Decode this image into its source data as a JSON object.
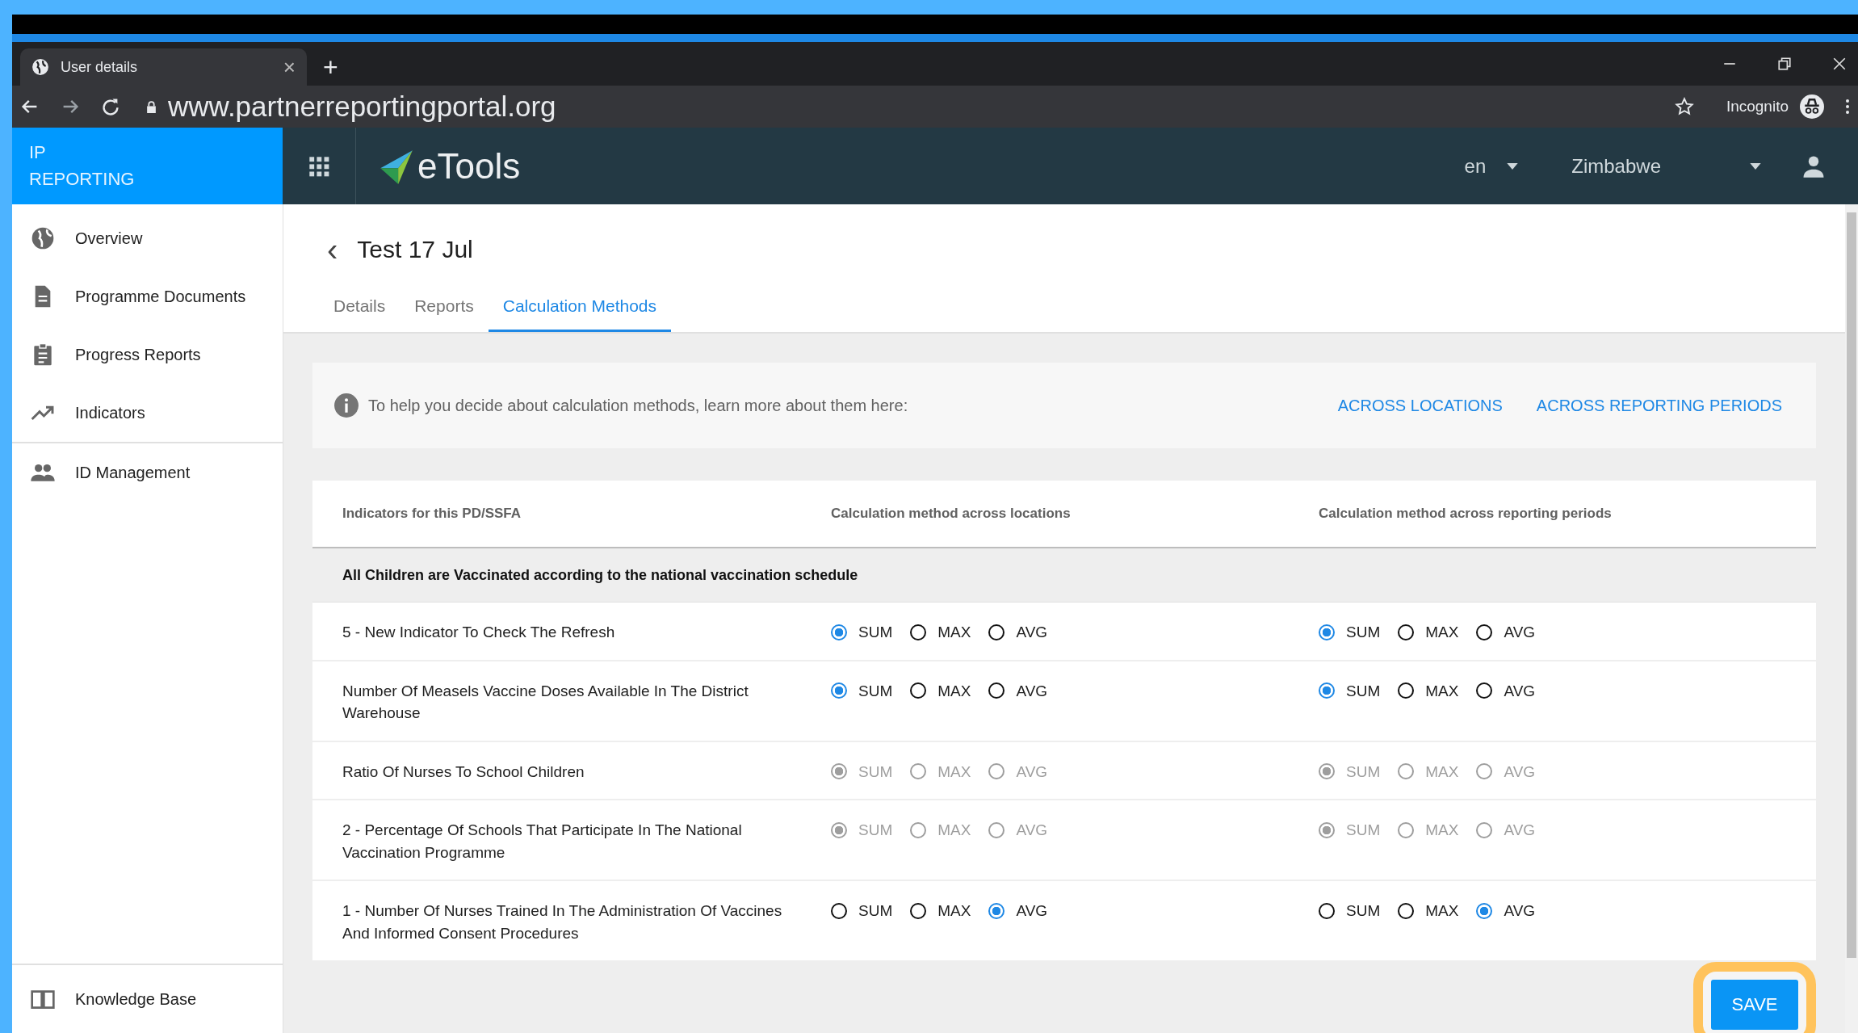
{
  "browser": {
    "tab": {
      "title": "User details",
      "close": "×"
    },
    "new_tab": "+",
    "url": "www.partnerreportingportal.org",
    "profile": "Incognito"
  },
  "app_header": {
    "brand": [
      "IP",
      "REPORTING"
    ],
    "logo_text": "eTools",
    "language": "en",
    "country": "Zimbabwe"
  },
  "sidebar": {
    "items": [
      {
        "label": "Overview",
        "kind": "globe",
        "selected": false
      },
      {
        "label": "Programme Documents",
        "kind": "document",
        "selected": false
      },
      {
        "label": "Progress Reports",
        "kind": "clipboard",
        "selected": false
      },
      {
        "label": "Indicators",
        "kind": "trend",
        "selected": false
      },
      {
        "label": "ID Management",
        "kind": "people",
        "selected": false
      }
    ],
    "footer_item": {
      "label": "Knowledge Base",
      "kind": "book"
    }
  },
  "page": {
    "back": "‹",
    "title": "Test 17 Jul",
    "tabs": [
      {
        "label": "Details",
        "selected": false
      },
      {
        "label": "Reports",
        "selected": false
      },
      {
        "label": "Calculation Methods",
        "selected": true
      }
    ]
  },
  "info": {
    "text": "To help you decide about calculation methods, learn more about them here:",
    "links": [
      "ACROSS LOCATIONS",
      "ACROSS REPORTING PERIODS"
    ]
  },
  "table": {
    "columns": [
      "Indicators for this PD/SSFA",
      "Calculation method across locations",
      "Calculation method across reporting periods"
    ],
    "group": "All Children are Vaccinated according to the national vaccination schedule",
    "rows": [
      {
        "indicator": "5 - New Indicator To Check The Refresh",
        "disabled": false,
        "locations": [
          {
            "label": "SUM",
            "selected": true
          },
          {
            "label": "MAX",
            "selected": false
          },
          {
            "label": "AVG",
            "selected": false
          }
        ],
        "periods": [
          {
            "label": "SUM",
            "selected": true
          },
          {
            "label": "MAX",
            "selected": false
          },
          {
            "label": "AVG",
            "selected": false
          }
        ]
      },
      {
        "indicator": "Number Of Measels Vaccine Doses Available In The District Warehouse",
        "disabled": false,
        "locations": [
          {
            "label": "SUM",
            "selected": true
          },
          {
            "label": "MAX",
            "selected": false
          },
          {
            "label": "AVG",
            "selected": false
          }
        ],
        "periods": [
          {
            "label": "SUM",
            "selected": true
          },
          {
            "label": "MAX",
            "selected": false
          },
          {
            "label": "AVG",
            "selected": false
          }
        ]
      },
      {
        "indicator": "Ratio Of Nurses To School Children",
        "disabled": true,
        "locations": [
          {
            "label": "SUM",
            "selected": true
          },
          {
            "label": "MAX",
            "selected": false
          },
          {
            "label": "AVG",
            "selected": false
          }
        ],
        "periods": [
          {
            "label": "SUM",
            "selected": true
          },
          {
            "label": "MAX",
            "selected": false
          },
          {
            "label": "AVG",
            "selected": false
          }
        ]
      },
      {
        "indicator": "2 - Percentage Of Schools That Participate In The National Vaccination Programme",
        "disabled": true,
        "locations": [
          {
            "label": "SUM",
            "selected": true
          },
          {
            "label": "MAX",
            "selected": false
          },
          {
            "label": "AVG",
            "selected": false
          }
        ],
        "periods": [
          {
            "label": "SUM",
            "selected": true
          },
          {
            "label": "MAX",
            "selected": false
          },
          {
            "label": "AVG",
            "selected": false
          }
        ]
      },
      {
        "indicator": "1 - Number Of Nurses Trained In The Administration Of Vaccines And Informed Consent Procedures",
        "disabled": false,
        "locations": [
          {
            "label": "SUM",
            "selected": false
          },
          {
            "label": "MAX",
            "selected": false
          },
          {
            "label": "AVG",
            "selected": true
          }
        ],
        "periods": [
          {
            "label": "SUM",
            "selected": false
          },
          {
            "label": "MAX",
            "selected": false
          },
          {
            "label": "AVG",
            "selected": true
          }
        ]
      }
    ]
  },
  "save_button": {
    "label": "SAVE",
    "highlighted": true
  }
}
